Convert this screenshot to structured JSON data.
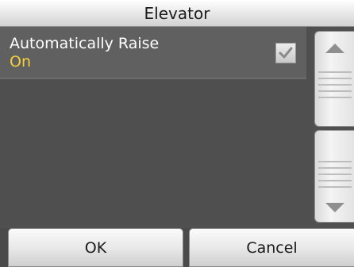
{
  "window": {
    "title": "Elevator"
  },
  "settings": [
    {
      "label": "Automatically Raise",
      "value": "On",
      "checked": true
    }
  ],
  "buttons": {
    "ok_label": "OK",
    "cancel_label": "Cancel"
  },
  "icons": {
    "check": "checkmark-icon",
    "up": "arrow-up-icon",
    "down": "arrow-down-icon"
  },
  "colors": {
    "value_text": "#f2d23c",
    "background": "#505050"
  }
}
